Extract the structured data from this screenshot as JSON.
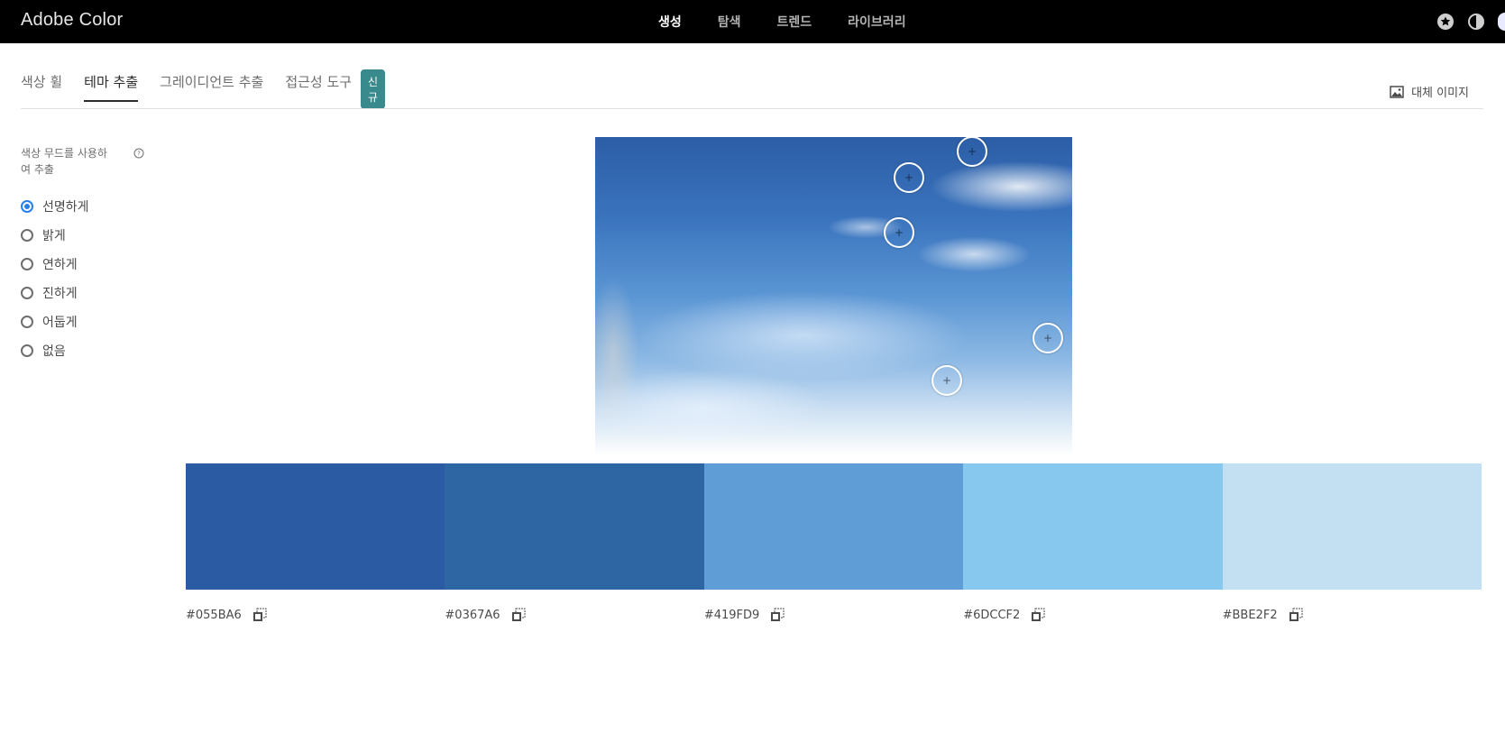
{
  "app": {
    "title": "Adobe Color"
  },
  "topnav": {
    "items": [
      "생성",
      "탐색",
      "트렌드",
      "라이브러리"
    ],
    "active": "생성"
  },
  "tabs": {
    "items": [
      "색상 휠",
      "테마 추출",
      "그레이디언트 추출",
      "접근성 도구"
    ],
    "active": "테마 추출",
    "badge": "신규"
  },
  "alt_image": {
    "label": "대체 이미지"
  },
  "mood": {
    "label": "색상 무드를 사용하여 추출",
    "options": [
      "선명하게",
      "밝게",
      "연하게",
      "진하게",
      "어둡게",
      "없음"
    ],
    "selected": "선명하게"
  },
  "palette": {
    "swatches": [
      {
        "hex": "#055BA6",
        "color": "#2b5ba2"
      },
      {
        "hex": "#0367A6",
        "color": "#2e66a3"
      },
      {
        "hex": "#419FD9",
        "color": "#5e9dd5"
      },
      {
        "hex": "#6DCCF2",
        "color": "#86c8ee"
      },
      {
        "hex": "#BBE2F2",
        "color": "#c2e0f2"
      }
    ]
  },
  "icons": {
    "top_right": [
      "star-badge-icon",
      "contrast-icon"
    ],
    "copy": "copy-icon",
    "help": "help-icon",
    "image": "image-icon"
  }
}
